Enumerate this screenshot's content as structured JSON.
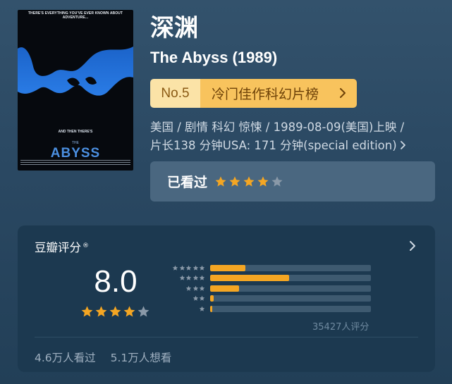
{
  "poster": {
    "tagline_top": "THERE'S EVERYTHING YOU'VE EVER KNOWN ABOUT ADVENTURE...",
    "tagline_mid": "AND THEN THERE'S",
    "title_small": "THE",
    "title_big": "ABYSS"
  },
  "movie": {
    "title_cn": "深渊",
    "title_en": "The Abyss (1989)"
  },
  "rank": {
    "number": "No.5",
    "list_name": "冷门佳作科幻片榜"
  },
  "meta": {
    "line1": "美国 / 剧情 科幻 惊悚 / 1989-08-09(美国)上映 /",
    "line2": "片长138 分钟USA: 171 分钟(special edition)"
  },
  "user": {
    "status_label": "已看过",
    "user_stars": 4
  },
  "rating": {
    "section_title": "豆瓣评分",
    "trademark": "®",
    "score": "8.0",
    "score_stars": 4,
    "distribution_percent": [
      22,
      49,
      18,
      2,
      0.5
    ],
    "rating_count": "35427人评分",
    "watched": "4.6万人看过",
    "want_to_watch": "5.1万人想看"
  },
  "colors": {
    "star_on": "#f4a623",
    "star_off": "#8a99a8",
    "rank_no_bg": "#fbe3a7",
    "rank_name_bg": "#f8c35d",
    "water_blue": "#1e6fd6"
  },
  "icons": {
    "star": "star-icon",
    "chevron": "chevron-right-icon"
  }
}
